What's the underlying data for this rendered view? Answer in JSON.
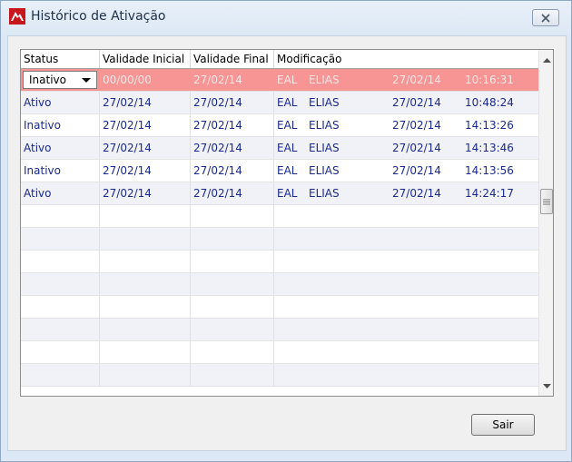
{
  "window": {
    "title": "Histórico de Ativação",
    "close_icon": "close-icon"
  },
  "columns": [
    "Status",
    "Validade Inicial",
    "Validade Final",
    "Modificação"
  ],
  "selected_status": "Inativo",
  "rows": [
    {
      "status": "",
      "validade_inicial": "00/00/00",
      "validade_final": "27/02/14",
      "user1": "EAL",
      "user2": "ELIAS",
      "data": "27/02/14",
      "hora": "10:16:31"
    },
    {
      "status": "Ativo",
      "validade_inicial": "27/02/14",
      "validade_final": "27/02/14",
      "user1": "EAL",
      "user2": "ELIAS",
      "data": "27/02/14",
      "hora": "10:48:24"
    },
    {
      "status": "Inativo",
      "validade_inicial": "27/02/14",
      "validade_final": "27/02/14",
      "user1": "EAL",
      "user2": "ELIAS",
      "data": "27/02/14",
      "hora": "14:13:26"
    },
    {
      "status": "Ativo",
      "validade_inicial": "27/02/14",
      "validade_final": "27/02/14",
      "user1": "EAL",
      "user2": "ELIAS",
      "data": "27/02/14",
      "hora": "14:13:46"
    },
    {
      "status": "Inativo",
      "validade_inicial": "27/02/14",
      "validade_final": "27/02/14",
      "user1": "EAL",
      "user2": "ELIAS",
      "data": "27/02/14",
      "hora": "14:13:56"
    },
    {
      "status": "Ativo",
      "validade_inicial": "27/02/14",
      "validade_final": "27/02/14",
      "user1": "EAL",
      "user2": "ELIAS",
      "data": "27/02/14",
      "hora": "14:24:17"
    }
  ],
  "buttons": {
    "sair": "Sair"
  },
  "colors": {
    "selected_row": "#f79494",
    "cell_text": "#1a2a8c"
  }
}
